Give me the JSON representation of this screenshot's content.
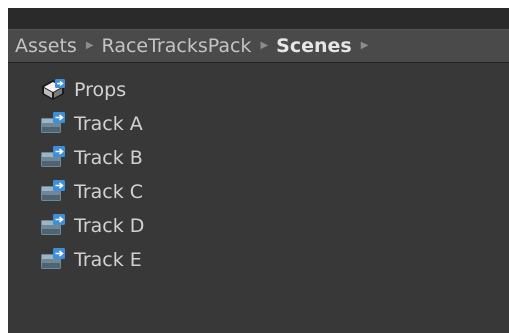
{
  "breadcrumb": {
    "items": [
      {
        "label": "Assets"
      },
      {
        "label": "RaceTracksPack"
      },
      {
        "label": "Scenes"
      }
    ],
    "separator": "▶",
    "trailing_separator": "▶"
  },
  "assets": [
    {
      "label": "Props",
      "icon": "prefab-icon"
    },
    {
      "label": "Track A",
      "icon": "scene-icon"
    },
    {
      "label": "Track B",
      "icon": "scene-icon"
    },
    {
      "label": "Track C",
      "icon": "scene-icon"
    },
    {
      "label": "Track D",
      "icon": "scene-icon"
    },
    {
      "label": "Track E",
      "icon": "scene-icon"
    }
  ],
  "colors": {
    "panel_background": "#383838",
    "breadcrumb_background": "#4a4a4a",
    "text": "#d2d2d2",
    "scene_icon_accent": "#3d8fd8"
  }
}
